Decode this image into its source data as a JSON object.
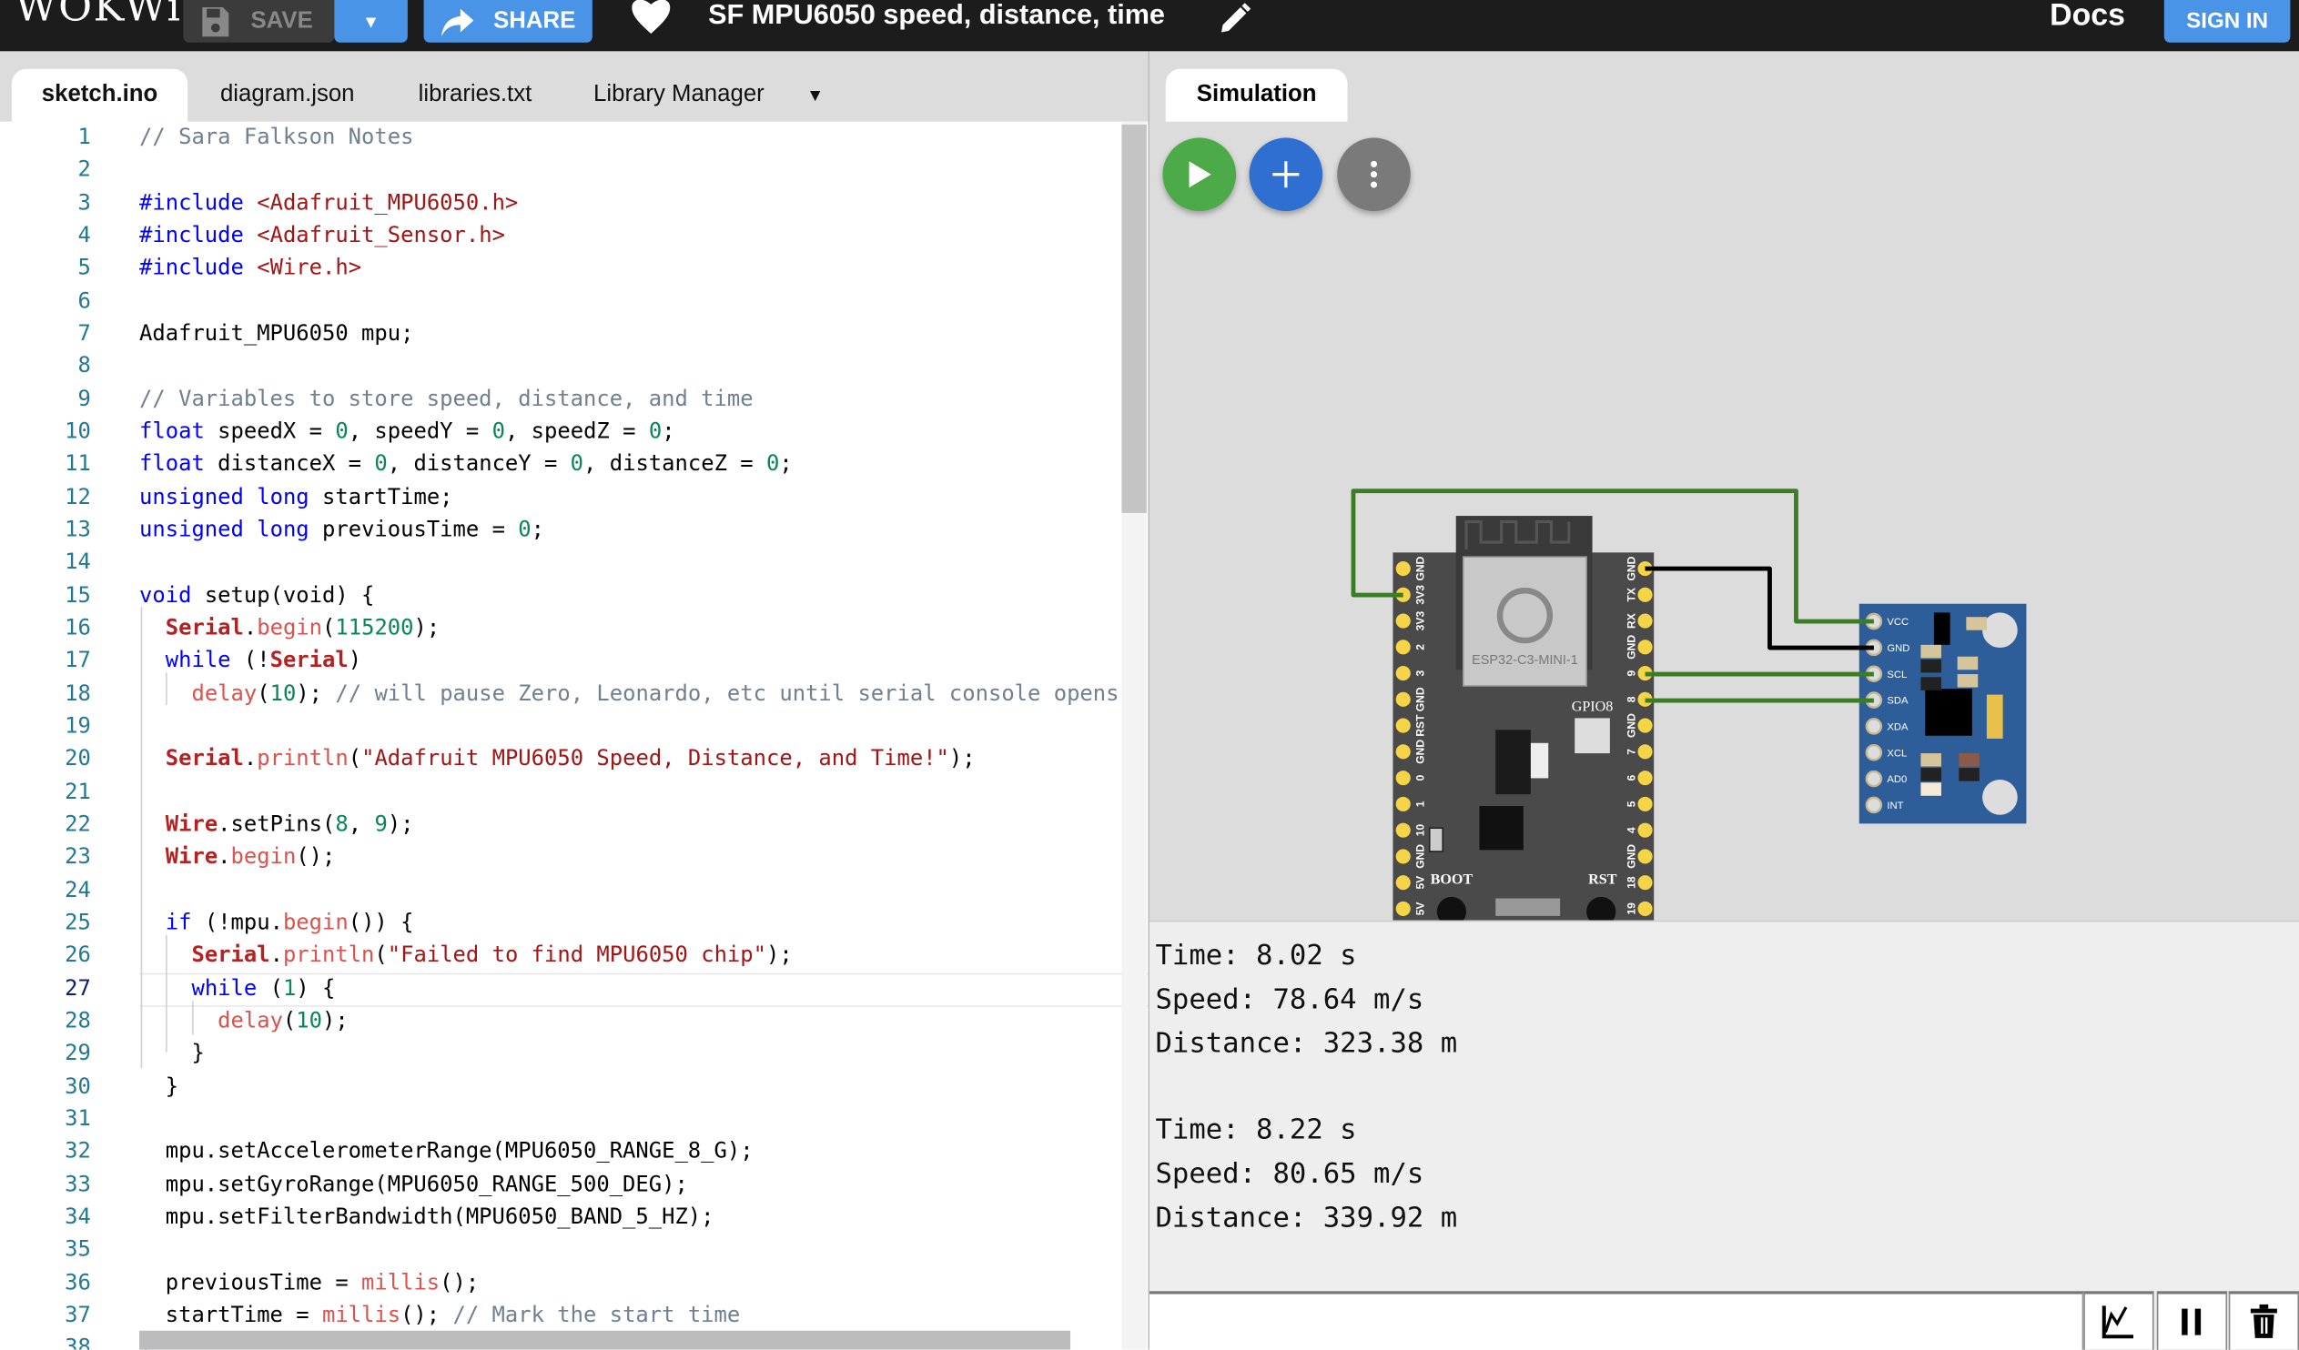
{
  "header": {
    "logo": "WOKWi",
    "save_label": "SAVE",
    "share_label": "SHARE",
    "project_title": "SF MPU6050 speed, distance, time",
    "docs_label": "Docs",
    "signin_label": "SIGN IN"
  },
  "editor": {
    "tabs": [
      {
        "label": "sketch.ino",
        "active": true
      },
      {
        "label": "diagram.json"
      },
      {
        "label": "libraries.txt"
      },
      {
        "label": "Library Manager"
      }
    ],
    "current_line": 27,
    "lines": [
      [
        [
          "c",
          "// Sara Falkson Notes"
        ]
      ],
      [],
      [
        [
          "k",
          "#include"
        ],
        [
          "p",
          " "
        ],
        [
          "s",
          "<Adafruit_MPU6050.h>"
        ]
      ],
      [
        [
          "k",
          "#include"
        ],
        [
          "p",
          " "
        ],
        [
          "s",
          "<Adafruit_Sensor.h>"
        ]
      ],
      [
        [
          "k",
          "#include"
        ],
        [
          "p",
          " "
        ],
        [
          "s",
          "<Wire.h>"
        ]
      ],
      [],
      [
        [
          "p",
          "Adafruit_MPU6050 mpu;"
        ]
      ],
      [],
      [
        [
          "c",
          "// Variables to store speed, distance, and time"
        ]
      ],
      [
        [
          "k",
          "float"
        ],
        [
          "p",
          " speedX = "
        ],
        [
          "n",
          "0"
        ],
        [
          "p",
          ", speedY = "
        ],
        [
          "n",
          "0"
        ],
        [
          "p",
          ", speedZ = "
        ],
        [
          "n",
          "0"
        ],
        [
          "p",
          ";"
        ]
      ],
      [
        [
          "k",
          "float"
        ],
        [
          "p",
          " distanceX = "
        ],
        [
          "n",
          "0"
        ],
        [
          "p",
          ", distanceY = "
        ],
        [
          "n",
          "0"
        ],
        [
          "p",
          ", distanceZ = "
        ],
        [
          "n",
          "0"
        ],
        [
          "p",
          ";"
        ]
      ],
      [
        [
          "k",
          "unsigned"
        ],
        [
          "p",
          " "
        ],
        [
          "k",
          "long"
        ],
        [
          "p",
          " startTime;"
        ]
      ],
      [
        [
          "k",
          "unsigned"
        ],
        [
          "p",
          " "
        ],
        [
          "k",
          "long"
        ],
        [
          "p",
          " previousTime = "
        ],
        [
          "n",
          "0"
        ],
        [
          "p",
          ";"
        ]
      ],
      [],
      [
        [
          "k",
          "void"
        ],
        [
          "p",
          " setup(void) {"
        ]
      ],
      [
        [
          "p",
          "  "
        ],
        [
          "o",
          "Serial"
        ],
        [
          "p",
          "."
        ],
        [
          "f",
          "begin"
        ],
        [
          "p",
          "("
        ],
        [
          "n",
          "115200"
        ],
        [
          "p",
          ");"
        ]
      ],
      [
        [
          "p",
          "  "
        ],
        [
          "k",
          "while"
        ],
        [
          "p",
          " (!"
        ],
        [
          "o",
          "Serial"
        ],
        [
          "p",
          ")"
        ]
      ],
      [
        [
          "p",
          "    "
        ],
        [
          "f",
          "delay"
        ],
        [
          "p",
          "("
        ],
        [
          "n",
          "10"
        ],
        [
          "p",
          "); "
        ],
        [
          "c",
          "// will pause Zero, Leonardo, etc until serial console opens"
        ]
      ],
      [],
      [
        [
          "p",
          "  "
        ],
        [
          "o",
          "Serial"
        ],
        [
          "p",
          "."
        ],
        [
          "f",
          "println"
        ],
        [
          "p",
          "("
        ],
        [
          "s",
          "\"Adafruit MPU6050 Speed, Distance, and Time!\""
        ],
        [
          "p",
          ");"
        ]
      ],
      [],
      [
        [
          "p",
          "  "
        ],
        [
          "o",
          "Wire"
        ],
        [
          "p",
          ".setPins("
        ],
        [
          "n",
          "8"
        ],
        [
          "p",
          ", "
        ],
        [
          "n",
          "9"
        ],
        [
          "p",
          ");"
        ]
      ],
      [
        [
          "p",
          "  "
        ],
        [
          "o",
          "Wire"
        ],
        [
          "p",
          "."
        ],
        [
          "f",
          "begin"
        ],
        [
          "p",
          "();"
        ]
      ],
      [],
      [
        [
          "p",
          "  "
        ],
        [
          "k",
          "if"
        ],
        [
          "p",
          " (!mpu."
        ],
        [
          "f",
          "begin"
        ],
        [
          "p",
          "()) {"
        ]
      ],
      [
        [
          "p",
          "    "
        ],
        [
          "o",
          "Serial"
        ],
        [
          "p",
          "."
        ],
        [
          "f",
          "println"
        ],
        [
          "p",
          "("
        ],
        [
          "s",
          "\"Failed to find MPU6050 chip\""
        ],
        [
          "p",
          ");"
        ]
      ],
      [
        [
          "p",
          "    "
        ],
        [
          "k",
          "while"
        ],
        [
          "p",
          " ("
        ],
        [
          "n",
          "1"
        ],
        [
          "p",
          ") {"
        ]
      ],
      [
        [
          "p",
          "      "
        ],
        [
          "f",
          "delay"
        ],
        [
          "p",
          "("
        ],
        [
          "n",
          "10"
        ],
        [
          "p",
          ");"
        ]
      ],
      [
        [
          "p",
          "    }"
        ]
      ],
      [
        [
          "p",
          "  }"
        ]
      ],
      [],
      [
        [
          "p",
          "  mpu.setAccelerometerRange(MPU6050_RANGE_8_G);"
        ]
      ],
      [
        [
          "p",
          "  mpu.setGyroRange(MPU6050_RANGE_500_DEG);"
        ]
      ],
      [
        [
          "p",
          "  mpu.setFilterBandwidth(MPU6050_BAND_5_HZ);"
        ]
      ],
      [],
      [
        [
          "p",
          "  previousTime = "
        ],
        [
          "f",
          "millis"
        ],
        [
          "p",
          "();"
        ]
      ],
      [
        [
          "p",
          "  startTime = "
        ],
        [
          "f",
          "millis"
        ],
        [
          "p",
          "(); "
        ],
        [
          "c",
          "// Mark the start time"
        ]
      ],
      [
        [
          "k",
          "}"
        ]
      ]
    ]
  },
  "simulation": {
    "tab_label": "Simulation",
    "buttons": [
      "play",
      "add-part",
      "more-options"
    ],
    "esp32": {
      "module_label": "ESP32-C3-MINI-1",
      "gpio_label": "GPIO8",
      "boot_label": "BOOT",
      "rst_label": "RST",
      "left_pins": [
        "GND",
        "3V3",
        "3V3",
        "2",
        "3",
        "GND",
        "RST",
        "GND",
        "0",
        "1",
        "10",
        "GND",
        "5V",
        "5V"
      ],
      "right_pins": [
        "GND",
        "TX",
        "RX",
        "GND",
        "9",
        "8",
        "GND",
        "7",
        "6",
        "5",
        "4",
        "GND",
        "18",
        "19"
      ]
    },
    "mpu6050": {
      "pins": [
        "VCC",
        "GND",
        "SCL",
        "SDA",
        "XDA",
        "XCL",
        "AD0",
        "INT"
      ]
    },
    "colors": {
      "board": "#4a4a4a",
      "pin": "#f5d547",
      "mpu": "#2e5e99",
      "wire_green": "#3a7d22",
      "wire_black": "#000000"
    }
  },
  "serial": {
    "lines": [
      "Time: 8.02 s",
      "Speed: 78.64 m/s",
      "Distance: 323.38 m",
      "",
      "Time: 8.22 s",
      "Speed: 80.65 m/s",
      "Distance: 339.92 m"
    ],
    "input_value": "",
    "buttons": [
      "plotter",
      "pause",
      "clear"
    ]
  }
}
